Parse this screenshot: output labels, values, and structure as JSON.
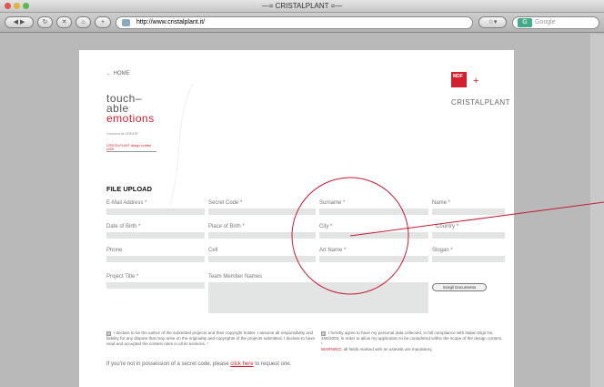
{
  "browser": {
    "window_title": "—= CRISTALPLANT =—",
    "url": "http://www.cristalplant.it/",
    "search_placeholder": "Google"
  },
  "page": {
    "back_link": "← HOME",
    "brand": {
      "line1": "touch–",
      "line2": "able",
      "line3": "emotions",
      "small_text": "Concours de CREATIF",
      "red_tag": "CRISTALPLANT design contest 2008"
    },
    "logo_mdf": "MDF",
    "logo_plus": "+",
    "logo_cristalplant": "CRISTALPLANT",
    "section_title": "FILE UPLOAD",
    "fields": {
      "email": "E-Mail Address *",
      "secret": "Secret Code *",
      "surname": "Surname *",
      "name": "Name *",
      "dob": "Date of Birth *",
      "pob": "Place of Birth *",
      "city": "City *",
      "country": "Country *",
      "phone": "Phone",
      "cell": "Cell",
      "art": "Art Name *",
      "slogan": "Slogan *",
      "project": "Project Title *",
      "team": "Team Member Names"
    },
    "upload_button": "Scegli Documento",
    "declaration_left": "I declare to be the author of the submitted projects and their copyright holder. I assume all responsibility and liability for any dispute that may arise on the originality and copyrights of the projects submitted. I declare to have read and accepted the contest rules in all its sections. *",
    "declaration_right": "I hereby agree to have my personal data collected, in full compliance with Italian Dlgs No. 196/2003, in order to allow my application to be considered within the scope of the design contest. *",
    "warning_label": "WARNING:",
    "warning_text": "all fields marked with an asterisk are mandatory.",
    "footer_before": "If you're not in possession of a secret code, please",
    "footer_link": "click here",
    "footer_after": "to request one."
  }
}
